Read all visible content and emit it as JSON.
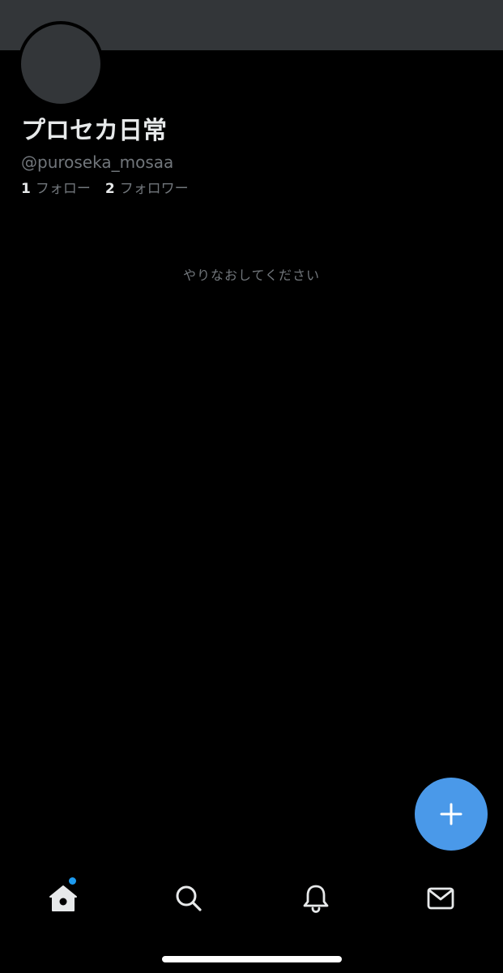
{
  "profile": {
    "display_name": "プロセカ日常",
    "handle": "@puroseka_mosaa",
    "following_count": "1",
    "following_label": "フォロー",
    "followers_count": "2",
    "followers_label": "フォロワー"
  },
  "timeline": {
    "error_message": "やりなおしてください"
  },
  "fab": {
    "icon": "plus-icon"
  },
  "tabbar": {
    "items": [
      {
        "name": "home",
        "icon": "home-icon",
        "active": true,
        "notification_dot": true
      },
      {
        "name": "search",
        "icon": "search-icon"
      },
      {
        "name": "notifications",
        "icon": "bell-icon"
      },
      {
        "name": "messages",
        "icon": "mail-icon"
      }
    ]
  },
  "colors": {
    "background": "#000000",
    "banner": "#333639",
    "accent": "#1d9bf0",
    "fab": "#4a99e9",
    "secondary_text": "#71767b",
    "primary_text": "#e7e9ea"
  }
}
